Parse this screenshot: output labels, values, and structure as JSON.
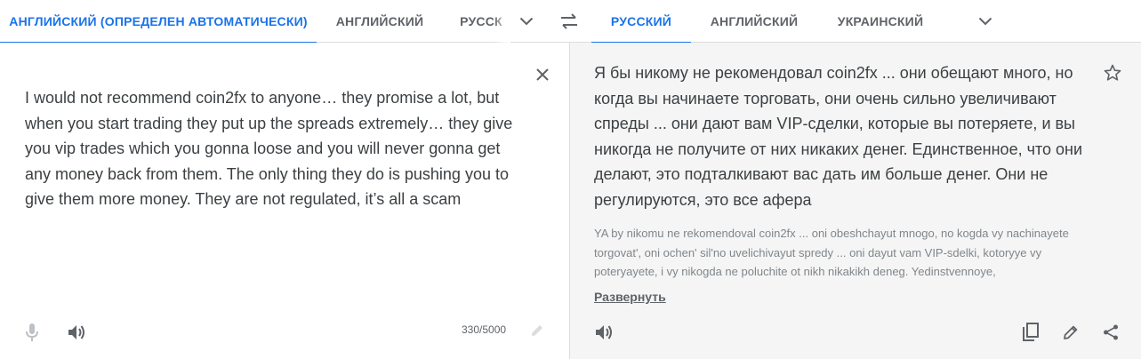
{
  "source_tabs": {
    "detected": "АНГЛИЙСКИЙ (ОПРЕДЕЛЕН АВТОМАТИЧЕСКИ)",
    "lang1": "АНГЛИЙСКИЙ",
    "lang2": "РУССК"
  },
  "target_tabs": {
    "active": "РУССКИЙ",
    "lang1": "АНГЛИЙСКИЙ",
    "lang2": "УКРАИНСКИЙ"
  },
  "source": {
    "text": "I would not recommend coin2fx to anyone… they promise a lot, but when you start trading they put up the spreads extremely… they give you vip trades which you gonna loose and you will never gonna get any money back from them. The only thing they do is pushing you to give them more money. They are not regulated, it’s all a scam",
    "char_count": "330/5000"
  },
  "target": {
    "text": "Я бы никому не рекомендовал coin2fx ... они обещают много, но когда вы начинаете торговать, они очень сильно увеличивают спреды ... они дают вам VIP-сделки, которые вы потеряете, и вы никогда не получите от них никаких денег. Единственное, что они делают, это подталкивают вас дать им больше денег. Они не регулируются, это все афера",
    "transliteration": "YA by nikomu ne rekomendoval coin2fx ... oni obeshchayut mnogo, no kogda vy nachinayete torgovat', oni ochen' sil'no uvelichivayut spredy ... oni dayut vam VIP-sdelki, kotoryye vy poteryayete, i vy nikogda ne poluchite ot nikh nikakikh deneg. Yedinstvennoye,",
    "expand_label": "Развернуть"
  },
  "colors": {
    "accent": "#1a73e8",
    "icon": "#5f6368",
    "icon_disabled": "#bdc1c6",
    "target_bg": "#f5f5f5"
  },
  "icons": [
    "chevron-down-icon",
    "swap-icon",
    "close-icon",
    "microphone-icon",
    "speaker-icon",
    "pencil-icon",
    "star-icon",
    "copy-icon",
    "share-icon"
  ]
}
